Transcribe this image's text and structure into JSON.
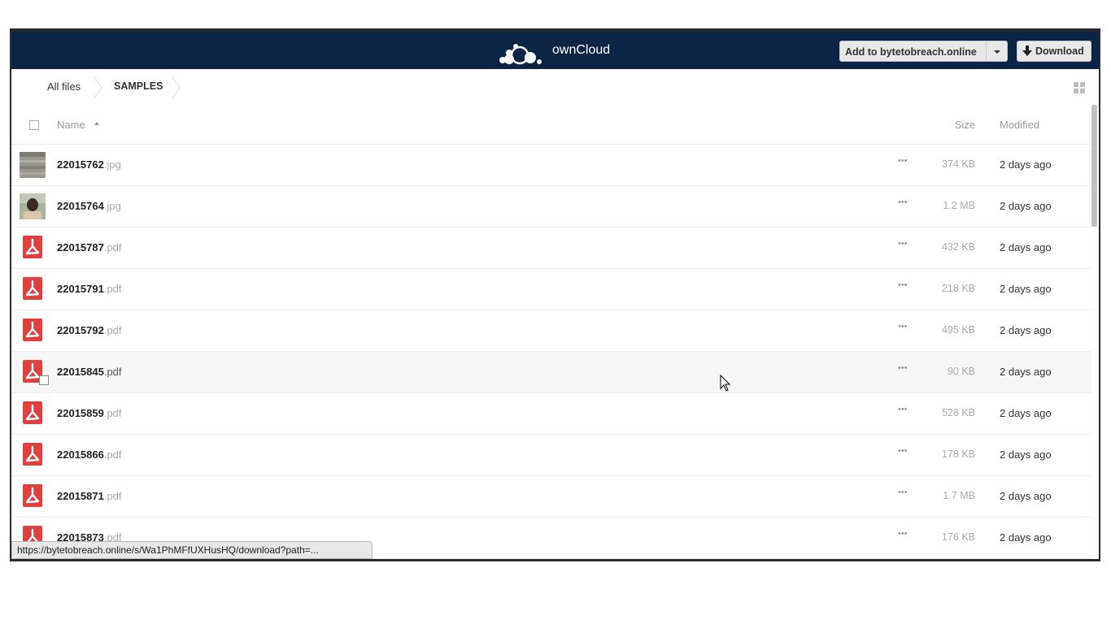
{
  "header": {
    "brand": "ownCloud",
    "add_button": "Add to bytetobreach.online",
    "download_button": "Download",
    "colors": {
      "header_bg": "#0d2545",
      "pdf_red": "#e04040"
    }
  },
  "breadcrumb": {
    "items": [
      "All files",
      "SAMPLES"
    ]
  },
  "table": {
    "headers": {
      "name": "Name",
      "size": "Size",
      "modified": "Modified"
    },
    "rows": [
      {
        "base": "22015762",
        "ext": ".jpg",
        "size": "374 KB",
        "modified": "2 days ago",
        "icon": "image-thumbnail"
      },
      {
        "base": "22015764",
        "ext": ".jpg",
        "size": "1.2 MB",
        "modified": "2 days ago",
        "icon": "image-thumbnail"
      },
      {
        "base": "22015787",
        "ext": ".pdf",
        "size": "432 KB",
        "modified": "2 days ago",
        "icon": "pdf-icon"
      },
      {
        "base": "22015791",
        "ext": ".pdf",
        "size": "218 KB",
        "modified": "2 days ago",
        "icon": "pdf-icon"
      },
      {
        "base": "22015792",
        "ext": ".pdf",
        "size": "495 KB",
        "modified": "2 days ago",
        "icon": "pdf-icon"
      },
      {
        "base": "22015845",
        "ext": ".pdf",
        "size": "90 KB",
        "modified": "2 days ago",
        "icon": "pdf-icon"
      },
      {
        "base": "22015859",
        "ext": ".pdf",
        "size": "528 KB",
        "modified": "2 days ago",
        "icon": "pdf-icon"
      },
      {
        "base": "22015866",
        "ext": ".pdf",
        "size": "178 KB",
        "modified": "2 days ago",
        "icon": "pdf-icon"
      },
      {
        "base": "22015871",
        "ext": ".pdf",
        "size": "1.7 MB",
        "modified": "2 days ago",
        "icon": "pdf-icon"
      },
      {
        "base": "22015873",
        "ext": ".pdf",
        "size": "176 KB",
        "modified": "2 days ago",
        "icon": "pdf-icon"
      }
    ],
    "actions_label": "•••"
  },
  "status_url": "https://bytetobreach.online/s/Wa1PhMFfUXHusHQ/download?path=..."
}
